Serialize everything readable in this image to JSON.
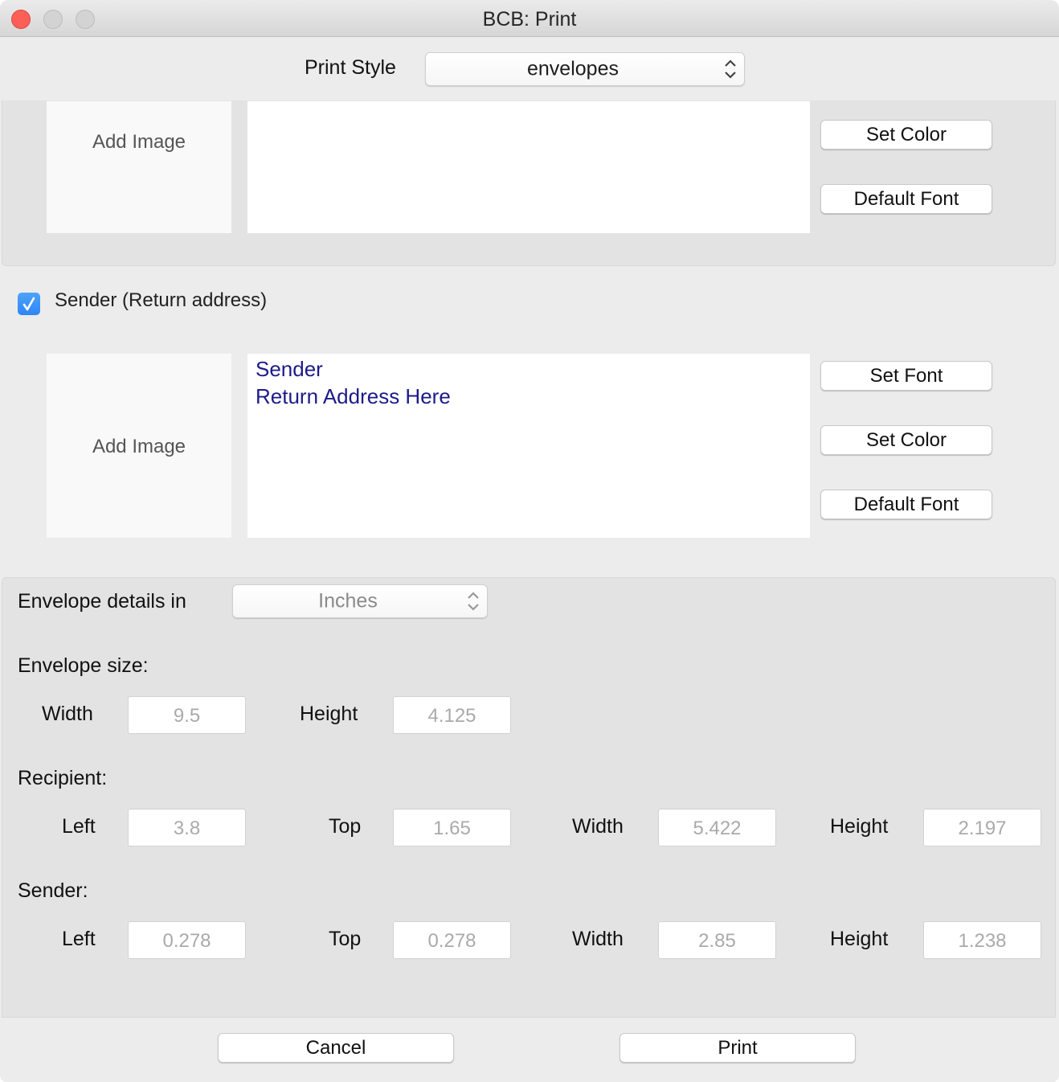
{
  "window": {
    "title": "BCB: Print",
    "traffic_lights": {
      "close": "close-icon",
      "minimize": "minimize-icon",
      "zoom": "zoom-icon"
    }
  },
  "print_style": {
    "label": "Print Style",
    "selected": "envelopes"
  },
  "recipient_section": {
    "add_image_label": "Add Image",
    "address_text": "",
    "buttons": {
      "set_color": "Set Color",
      "default_font": "Default Font"
    }
  },
  "sender_section": {
    "checkbox_label": "Sender (Return address)",
    "checked": true,
    "add_image_label": "Add Image",
    "address_lines": [
      "Sender",
      "Return Address Here"
    ],
    "buttons": {
      "set_font": "Set Font",
      "set_color": "Set Color",
      "default_font": "Default Font"
    }
  },
  "envelope_details": {
    "units_label": "Envelope details in",
    "units_selected": "Inches",
    "size": {
      "heading": "Envelope size:",
      "width_label": "Width",
      "width": "9.5",
      "height_label": "Height",
      "height": "4.125"
    },
    "recipient": {
      "heading": "Recipient:",
      "left_label": "Left",
      "left": "3.8",
      "top_label": "Top",
      "top": "1.65",
      "width_label": "Width",
      "width": "5.422",
      "height_label": "Height",
      "height": "2.197"
    },
    "sender": {
      "heading": "Sender:",
      "left_label": "Left",
      "left": "0.278",
      "top_label": "Top",
      "top": "0.278",
      "width_label": "Width",
      "width": "2.85",
      "height_label": "Height",
      "height": "1.238"
    }
  },
  "footer": {
    "cancel": "Cancel",
    "print": "Print"
  },
  "colors": {
    "checkbox_accent": "#2d86f5",
    "address_text": "#1d1b8a",
    "close_button": "#fc5f57"
  }
}
